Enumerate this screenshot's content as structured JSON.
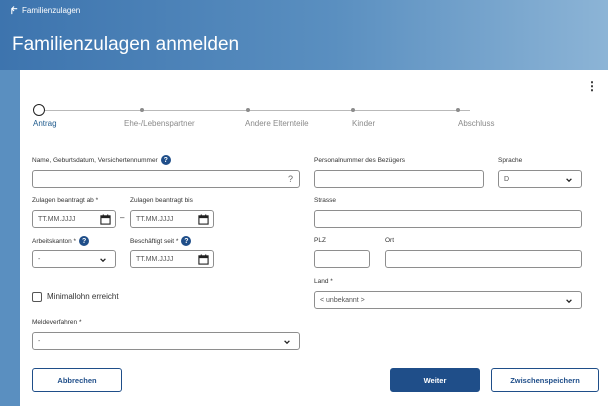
{
  "header": {
    "back_label": "Familienzulagen",
    "title": "Familienzulagen anmelden"
  },
  "stepper": {
    "steps": [
      {
        "label": "Antrag",
        "active": true
      },
      {
        "label": "Ehe-/Lebenspartner",
        "active": false
      },
      {
        "label": "Andere Elternteile",
        "active": false
      },
      {
        "label": "Kinder",
        "active": false
      },
      {
        "label": "Abschluss",
        "active": false
      }
    ]
  },
  "form": {
    "name_label": "Name, Geburtsdatum, Versichertennummer",
    "name_value": "",
    "name_suffix": "?",
    "personalnummer_label": "Personalnummer des Bezügers",
    "sprache_label": "Sprache",
    "sprache_value": "D",
    "zulagen_ab_label": "Zulagen beantragt ab *",
    "zulagen_ab_placeholder": "TT.MM.JJJJ",
    "zulagen_dash": "–",
    "zulagen_bis_label": "Zulagen beantragt bis",
    "zulagen_bis_placeholder": "TT.MM.JJJJ",
    "strasse_label": "Strasse",
    "arbeitskanton_label": "Arbeitskanton *",
    "arbeitskanton_value": "-",
    "beschaeftigt_label": "Beschäftigt seit *",
    "beschaeftigt_placeholder": "TT.MM.JJJJ",
    "plz_label": "PLZ",
    "ort_label": "Ort",
    "land_label": "Land *",
    "land_value": "< unbekannt >",
    "minimallohn_label": "Minimallohn erreicht",
    "meldeverfahren_label": "Meldeverfahren *",
    "meldeverfahren_value": "-"
  },
  "buttons": {
    "cancel": "Abbrechen",
    "next": "Weiter",
    "save": "Zwischenspeichern"
  },
  "colors": {
    "primary": "#1f4e89",
    "header_start": "#3d74ae",
    "header_end": "#8cb4d6"
  }
}
